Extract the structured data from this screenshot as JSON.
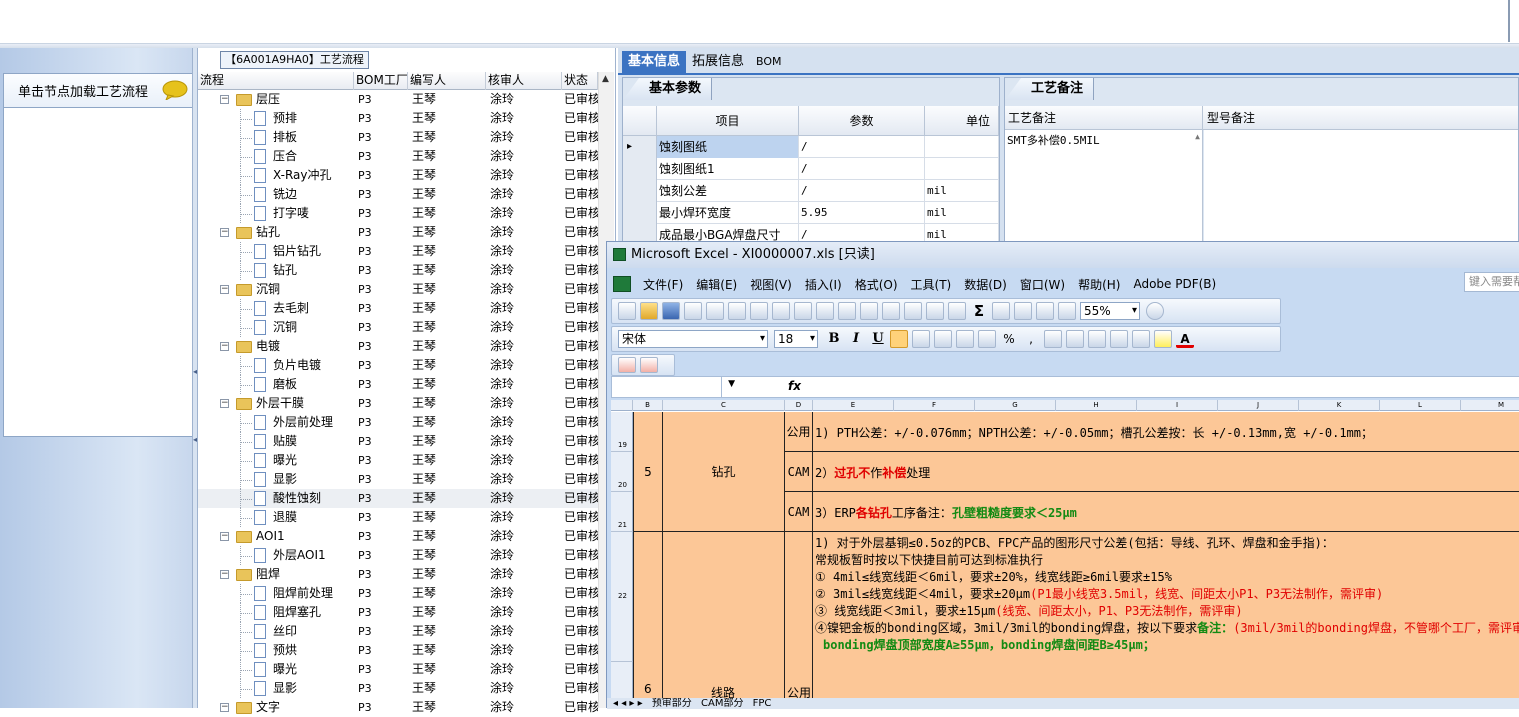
{
  "left": {
    "load_prompt": "单击节点加载工艺流程"
  },
  "tree": {
    "title": "【6A001A9HA0】工艺流程",
    "headers": [
      "流程",
      "BOM工厂",
      "编写人",
      "核审人",
      "状态"
    ],
    "rows": [
      {
        "level": 0,
        "label": "层压",
        "bom": "P3",
        "writer": "王琴",
        "reviewer": "涂玲",
        "status": "已审核"
      },
      {
        "level": 1,
        "label": "预排",
        "bom": "P3",
        "writer": "王琴",
        "reviewer": "涂玲",
        "status": "已审核"
      },
      {
        "level": 1,
        "label": "排板",
        "bom": "P3",
        "writer": "王琴",
        "reviewer": "涂玲",
        "status": "已审核"
      },
      {
        "level": 1,
        "label": "压合",
        "bom": "P3",
        "writer": "王琴",
        "reviewer": "涂玲",
        "status": "已审核"
      },
      {
        "level": 1,
        "label": "X-Ray冲孔",
        "bom": "P3",
        "writer": "王琴",
        "reviewer": "涂玲",
        "status": "已审核"
      },
      {
        "level": 1,
        "label": "铣边",
        "bom": "P3",
        "writer": "王琴",
        "reviewer": "涂玲",
        "status": "已审核"
      },
      {
        "level": 1,
        "label": "打字唛",
        "bom": "P3",
        "writer": "王琴",
        "reviewer": "涂玲",
        "status": "已审核"
      },
      {
        "level": 0,
        "label": "钻孔",
        "bom": "P3",
        "writer": "王琴",
        "reviewer": "涂玲",
        "status": "已审核"
      },
      {
        "level": 1,
        "label": "铝片钻孔",
        "bom": "P3",
        "writer": "王琴",
        "reviewer": "涂玲",
        "status": "已审核"
      },
      {
        "level": 1,
        "label": "钻孔",
        "bom": "P3",
        "writer": "王琴",
        "reviewer": "涂玲",
        "status": "已审核"
      },
      {
        "level": 0,
        "label": "沉铜",
        "bom": "P3",
        "writer": "王琴",
        "reviewer": "涂玲",
        "status": "已审核"
      },
      {
        "level": 1,
        "label": "去毛刺",
        "bom": "P3",
        "writer": "王琴",
        "reviewer": "涂玲",
        "status": "已审核"
      },
      {
        "level": 1,
        "label": "沉铜",
        "bom": "P3",
        "writer": "王琴",
        "reviewer": "涂玲",
        "status": "已审核"
      },
      {
        "level": 0,
        "label": "电镀",
        "bom": "P3",
        "writer": "王琴",
        "reviewer": "涂玲",
        "status": "已审核"
      },
      {
        "level": 1,
        "label": "负片电镀",
        "bom": "P3",
        "writer": "王琴",
        "reviewer": "涂玲",
        "status": "已审核"
      },
      {
        "level": 1,
        "label": "磨板",
        "bom": "P3",
        "writer": "王琴",
        "reviewer": "涂玲",
        "status": "已审核"
      },
      {
        "level": 0,
        "label": "外层干膜",
        "bom": "P3",
        "writer": "王琴",
        "reviewer": "涂玲",
        "status": "已审核"
      },
      {
        "level": 1,
        "label": "外层前处理",
        "bom": "P3",
        "writer": "王琴",
        "reviewer": "涂玲",
        "status": "已审核"
      },
      {
        "level": 1,
        "label": "贴膜",
        "bom": "P3",
        "writer": "王琴",
        "reviewer": "涂玲",
        "status": "已审核"
      },
      {
        "level": 1,
        "label": "曝光",
        "bom": "P3",
        "writer": "王琴",
        "reviewer": "涂玲",
        "status": "已审核"
      },
      {
        "level": 1,
        "label": "显影",
        "bom": "P3",
        "writer": "王琴",
        "reviewer": "涂玲",
        "status": "已审核"
      },
      {
        "level": 1,
        "label": "酸性蚀刻",
        "bom": "P3",
        "writer": "王琴",
        "reviewer": "涂玲",
        "status": "已审核",
        "selected": true
      },
      {
        "level": 1,
        "label": "退膜",
        "bom": "P3",
        "writer": "王琴",
        "reviewer": "涂玲",
        "status": "已审核"
      },
      {
        "level": 0,
        "label": "AOI1",
        "bom": "P3",
        "writer": "王琴",
        "reviewer": "涂玲",
        "status": "已审核"
      },
      {
        "level": 1,
        "label": "外层AOI1",
        "bom": "P3",
        "writer": "王琴",
        "reviewer": "涂玲",
        "status": "已审核"
      },
      {
        "level": 0,
        "label": "阻焊",
        "bom": "P3",
        "writer": "王琴",
        "reviewer": "涂玲",
        "status": "已审核"
      },
      {
        "level": 1,
        "label": "阻焊前处理",
        "bom": "P3",
        "writer": "王琴",
        "reviewer": "涂玲",
        "status": "已审核"
      },
      {
        "level": 1,
        "label": "阻焊塞孔",
        "bom": "P3",
        "writer": "王琴",
        "reviewer": "涂玲",
        "status": "已审核"
      },
      {
        "level": 1,
        "label": "丝印",
        "bom": "P3",
        "writer": "王琴",
        "reviewer": "涂玲",
        "status": "已审核"
      },
      {
        "level": 1,
        "label": "预烘",
        "bom": "P3",
        "writer": "王琴",
        "reviewer": "涂玲",
        "status": "已审核"
      },
      {
        "level": 1,
        "label": "曝光",
        "bom": "P3",
        "writer": "王琴",
        "reviewer": "涂玲",
        "status": "已审核"
      },
      {
        "level": 1,
        "label": "显影",
        "bom": "P3",
        "writer": "王琴",
        "reviewer": "涂玲",
        "status": "已审核"
      },
      {
        "level": 0,
        "label": "文字",
        "bom": "P3",
        "writer": "王琴",
        "reviewer": "涂玲",
        "status": "已审核"
      }
    ]
  },
  "tabs": [
    "基本信息",
    "拓展信息",
    "BOM"
  ],
  "basic": {
    "group_title": "基本参数",
    "headers": [
      "项目",
      "参数",
      "单位"
    ],
    "rows": [
      {
        "item": "蚀刻图纸",
        "param": "/",
        "unit": ""
      },
      {
        "item": "蚀刻图纸1",
        "param": "/",
        "unit": ""
      },
      {
        "item": "蚀刻公差",
        "param": "/",
        "unit": "mil"
      },
      {
        "item": "最小焊环宽度",
        "param": "5.95",
        "unit": "mil"
      },
      {
        "item": "成品最小BGA焊盘尺寸",
        "param": "/",
        "unit": "mil"
      }
    ]
  },
  "memo": {
    "group_title": "工艺备注",
    "col1": "工艺备注",
    "col2": "型号备注",
    "value": "SMT多补偿0.5MIL"
  },
  "excel": {
    "title": "Microsoft Excel - XI0000007.xls  [只读]",
    "menu": [
      "文件(F)",
      "编辑(E)",
      "视图(V)",
      "插入(I)",
      "格式(O)",
      "工具(T)",
      "数据(D)",
      "窗口(W)",
      "帮助(H)",
      "Adobe PDF(B)"
    ],
    "help_placeholder": "键入需要帮助的问题",
    "zoom": "55%",
    "font_name": "宋体",
    "font_size": "18",
    "fx": "fx",
    "columns": [
      "B",
      "C",
      "D",
      "E",
      "F",
      "G",
      "H",
      "I",
      "J",
      "K",
      "L",
      "M"
    ],
    "row_numbers": [
      "19",
      "20",
      "21",
      "22"
    ],
    "row_num_bottom": "6",
    "drill": {
      "num": "5",
      "name": "钻孔",
      "r1_type": "公用",
      "r1_text": "1) PTH公差：+/-0.076mm；NPTH公差：+/-0.05mm；槽孔公差按：长 +/-0.13mm,宽 +/-0.1mm；",
      "r2_type": "CAM",
      "r2_prefix": "2）",
      "r2_red1": "过孔不",
      "r2_mid": "作",
      "r2_red2": "补偿",
      "r2_suffix": "处理",
      "r3_type": "CAM",
      "r3_prefix": "3）ERP",
      "r3_red": "各钻孔",
      "r3_mid": "工序备注：",
      "r3_green": "孔壁粗糙度要求＜25μm"
    },
    "line": {
      "name": "线路",
      "type": "公用",
      "l1": "1) 对于外层基铜≤0.5oz的PCB、FPC产品的图形尺寸公差(包括：导线、孔环、焊盘和金手指)：",
      "l2": "常规板暂时按以下快捷目前可达到标准执行",
      "l3": "① 4mil≤线宽线距＜6mil，要求±20%，线宽线距≥6mil要求±15%",
      "l4a": "② 3mil≤线宽线距＜4mil，要求±20μm",
      "l4b": "(P1最小线宽3.5mil，线宽、间距太小P1、P3无法制作，需评审)",
      "l5a": "③ 线宽线距＜3mil，要求±15μm",
      "l5b": "(线宽、间距太小，P1、P3无法制作，需评审)",
      "l6a": "④镍钯金板的bonding区域，3mil/3mil的bonding焊盘，按以下要求",
      "l6b": "备注：",
      "l6c": "(3mil/3mil的bonding焊盘，不管哪个工厂，需评审)",
      "l7": "bonding焊盘顶部宽度A≥55μm，bonding焊盘间距B≥45μm；"
    },
    "sheet_tabs": [
      "预审部分",
      "CAM部分",
      "FPC"
    ]
  }
}
